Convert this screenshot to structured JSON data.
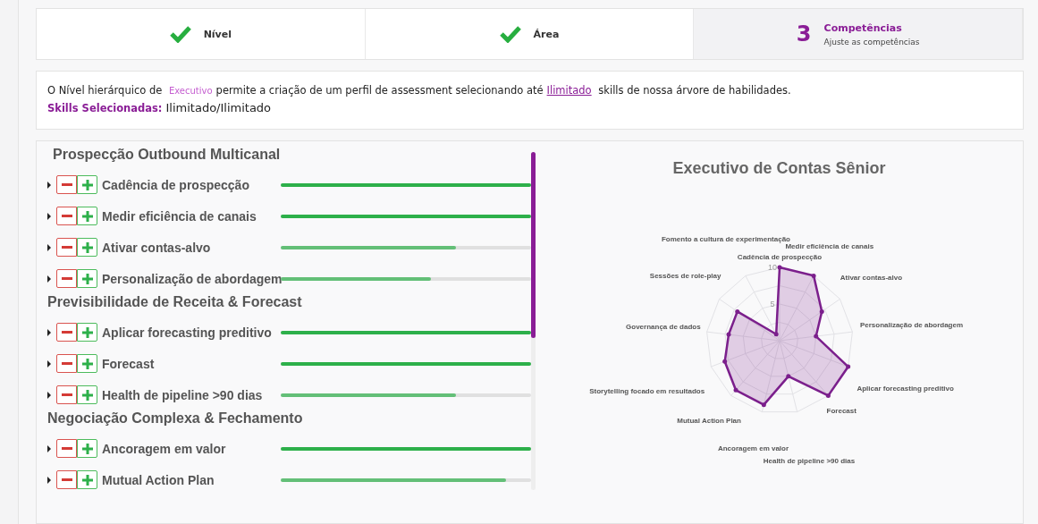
{
  "steps": [
    {
      "title": "Nível",
      "completed": true,
      "selected": false
    },
    {
      "title": "Área",
      "completed": true,
      "selected": false
    },
    {
      "number": "3",
      "title": "Competências",
      "subtitle": "Ajuste as competências",
      "completed": false,
      "selected": true
    }
  ],
  "info": {
    "before": "O Nível hierárquico de ",
    "level_link": "Executivo",
    "middle": " permite a criação de um perfil de assessment selecionando até ",
    "limit_link": "Ilimitado",
    "after": " skills de nossa árvore de habilidades.",
    "selected_label": "Skills Selecionadas:",
    "selected_value": "Ilimitado/Ilimitado"
  },
  "groups": [
    {
      "title": "Prospecção Outbound Multicanal",
      "skills": [
        {
          "name": "Cadência de prospecção",
          "level": 1.0
        },
        {
          "name": "Medir eficiência de canais",
          "level": 1.0
        },
        {
          "name": "Ativar contas-alvo",
          "level": 0.7
        },
        {
          "name": "Personalização de abordagem",
          "level": 0.6
        }
      ]
    },
    {
      "title": "Previsibilidade de Receita & Forecast",
      "skills": [
        {
          "name": "Aplicar forecasting preditivo",
          "level": 1.0
        },
        {
          "name": "Forecast",
          "level": 1.0
        },
        {
          "name": "Health de pipeline >90 dias",
          "level": 0.7
        }
      ]
    },
    {
      "title": "Negociação Complexa & Fechamento",
      "skills": [
        {
          "name": "Ancoragem em valor",
          "level": 1.0
        },
        {
          "name": "Mutual Action Plan",
          "level": 0.9
        }
      ]
    }
  ],
  "chart": {
    "title": "Executivo de Contas Sênior",
    "chart_data": {
      "type": "radar",
      "categories": [
        "Cadência de prospecção",
        "Medir eficiência de canais",
        "Ativar contas-alvo",
        "Personalização de abordagem",
        "Aplicar forecasting preditivo",
        "Forecast",
        "Health de pipeline >90 dias",
        "Ancoragem em valor",
        "Mutual Action Plan",
        "Storytelling focado em resultados",
        "Governança de dados",
        "Sessões de role-play",
        "Fomento a cultura de experimentação"
      ],
      "series": [
        {
          "color": "#7b1f8c",
          "values": [
            10,
            10,
            7,
            5,
            10,
            10,
            5,
            9,
            9,
            8,
            7,
            7,
            1
          ]
        }
      ],
      "ylim": [
        0,
        10
      ],
      "yticks": [
        5,
        10
      ]
    }
  }
}
